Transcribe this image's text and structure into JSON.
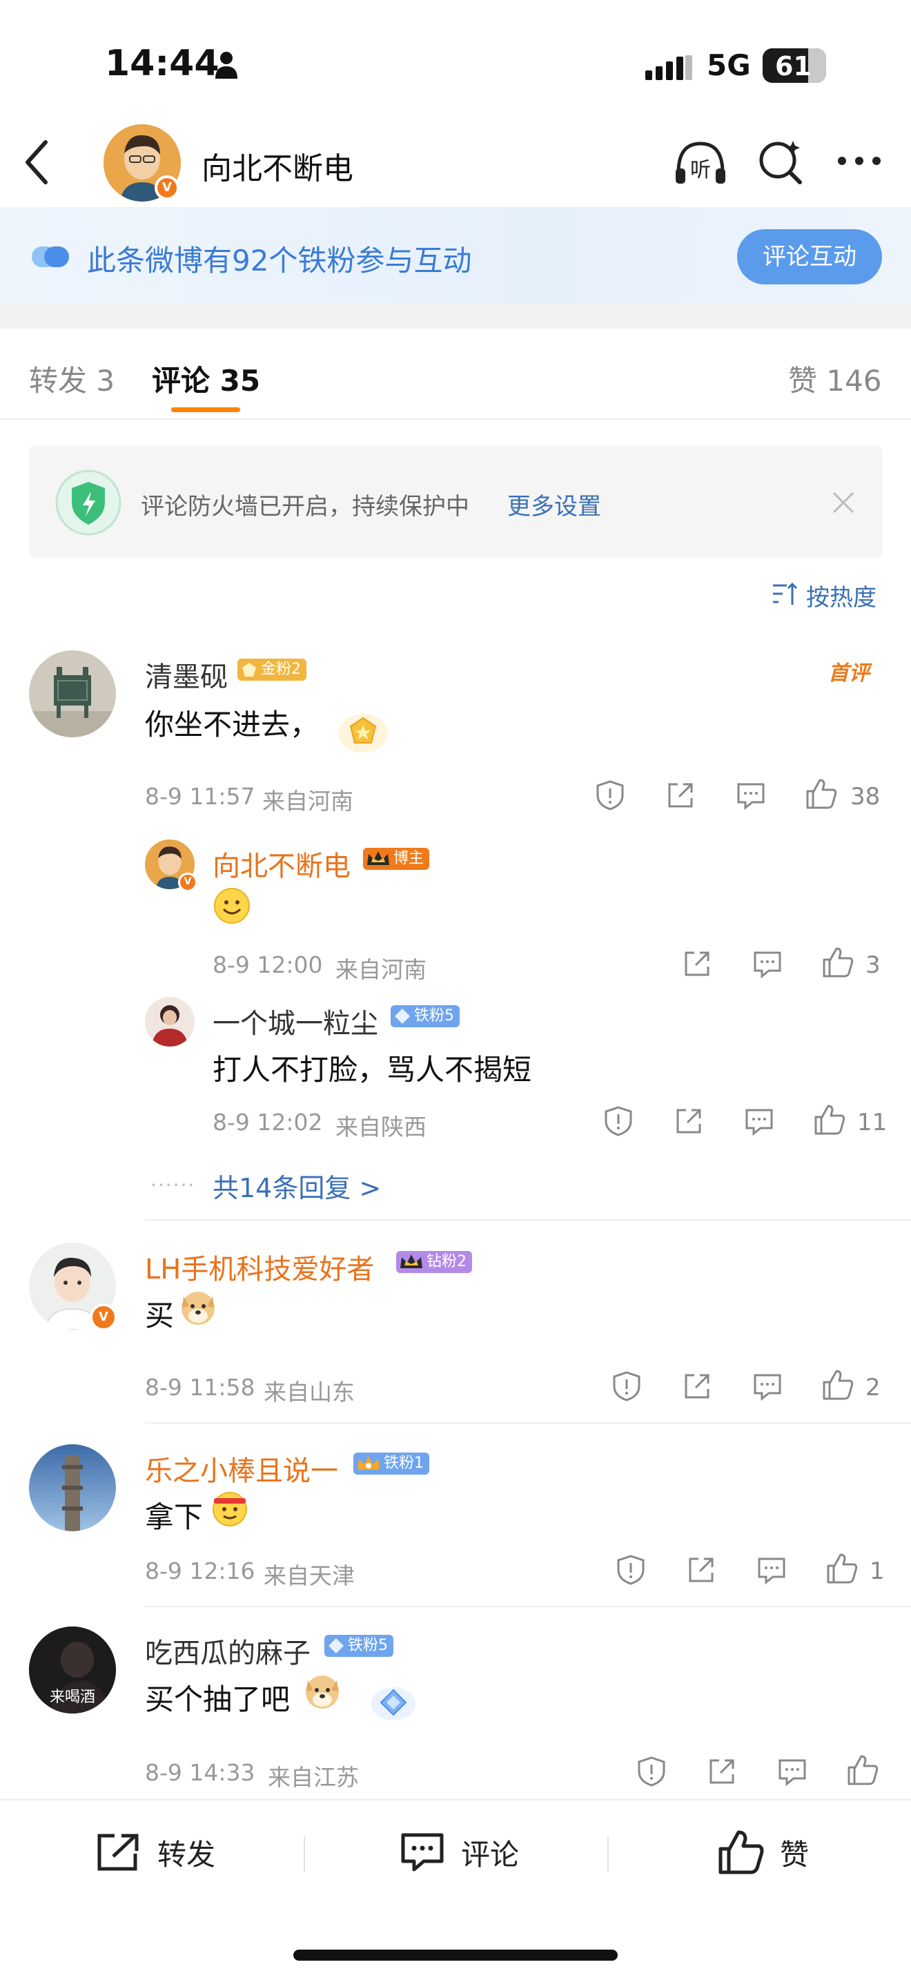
{
  "status_bar": {
    "time": "14:44",
    "network": "5G",
    "battery": "61",
    "battery_level": 0.61
  },
  "nav": {
    "title": "向北不断电",
    "avatar_badge": "V",
    "icons": [
      "back-icon",
      "listen-icon",
      "search-icon",
      "more-icon"
    ],
    "listen_label": "听"
  },
  "fan_banner": {
    "text": "此条微博有92个铁粉参与互动",
    "button": "评论互动"
  },
  "tabs": [
    {
      "label": "转发 3",
      "active": false
    },
    {
      "label": "评论 35",
      "active": true
    },
    {
      "label": "赞 146",
      "active": false
    }
  ],
  "notice": {
    "text": "评论防火墙已开启，持续保护中",
    "link": "更多设置"
  },
  "sort": {
    "label": "按热度"
  },
  "comments": [
    {
      "user": "清墨砚",
      "badge": "金粉2",
      "text": "你坐不进去，",
      "tag": "首评",
      "time": "8-9 11:57",
      "location": "来自河南",
      "likes": "38",
      "replies": [
        {
          "user": "向北不断电",
          "badge": "博主",
          "text": "🙂",
          "time": "8-9 12:00",
          "location": "来自河南",
          "likes": "3"
        },
        {
          "user": "一个城一粒尘",
          "badge": "铁粉5",
          "text": "打人不打脸，骂人不揭短",
          "time": "8-9 12:02",
          "location": "来自陕西",
          "likes": "11"
        }
      ],
      "more_replies": "共14条回复 >"
    },
    {
      "user": "LH手机科技爱好者",
      "badge": "钻粉2",
      "avatar_badge": "V",
      "text": "买",
      "time": "8-9 11:58",
      "location": "来自山东",
      "likes": "2"
    },
    {
      "user": "乐之小棒且说一",
      "badge": "铁粉1",
      "text": "拿下",
      "time": "8-9 12:16",
      "location": "来自天津",
      "likes": "1"
    },
    {
      "user": "吃西瓜的麻子",
      "badge": "铁粉5",
      "avatar_text": "来喝酒",
      "text": "买个抽了吧",
      "time": "8-9 14:33",
      "location": "来自江苏",
      "likes": ""
    }
  ],
  "bottom_bar": {
    "repost": "转发",
    "comment": "评论",
    "like": "赞"
  },
  "colors": {
    "accent": "#ff8200",
    "link": "#3a6fb8",
    "orange_name": "#e8731c",
    "banner_button": "#5a9bec"
  }
}
